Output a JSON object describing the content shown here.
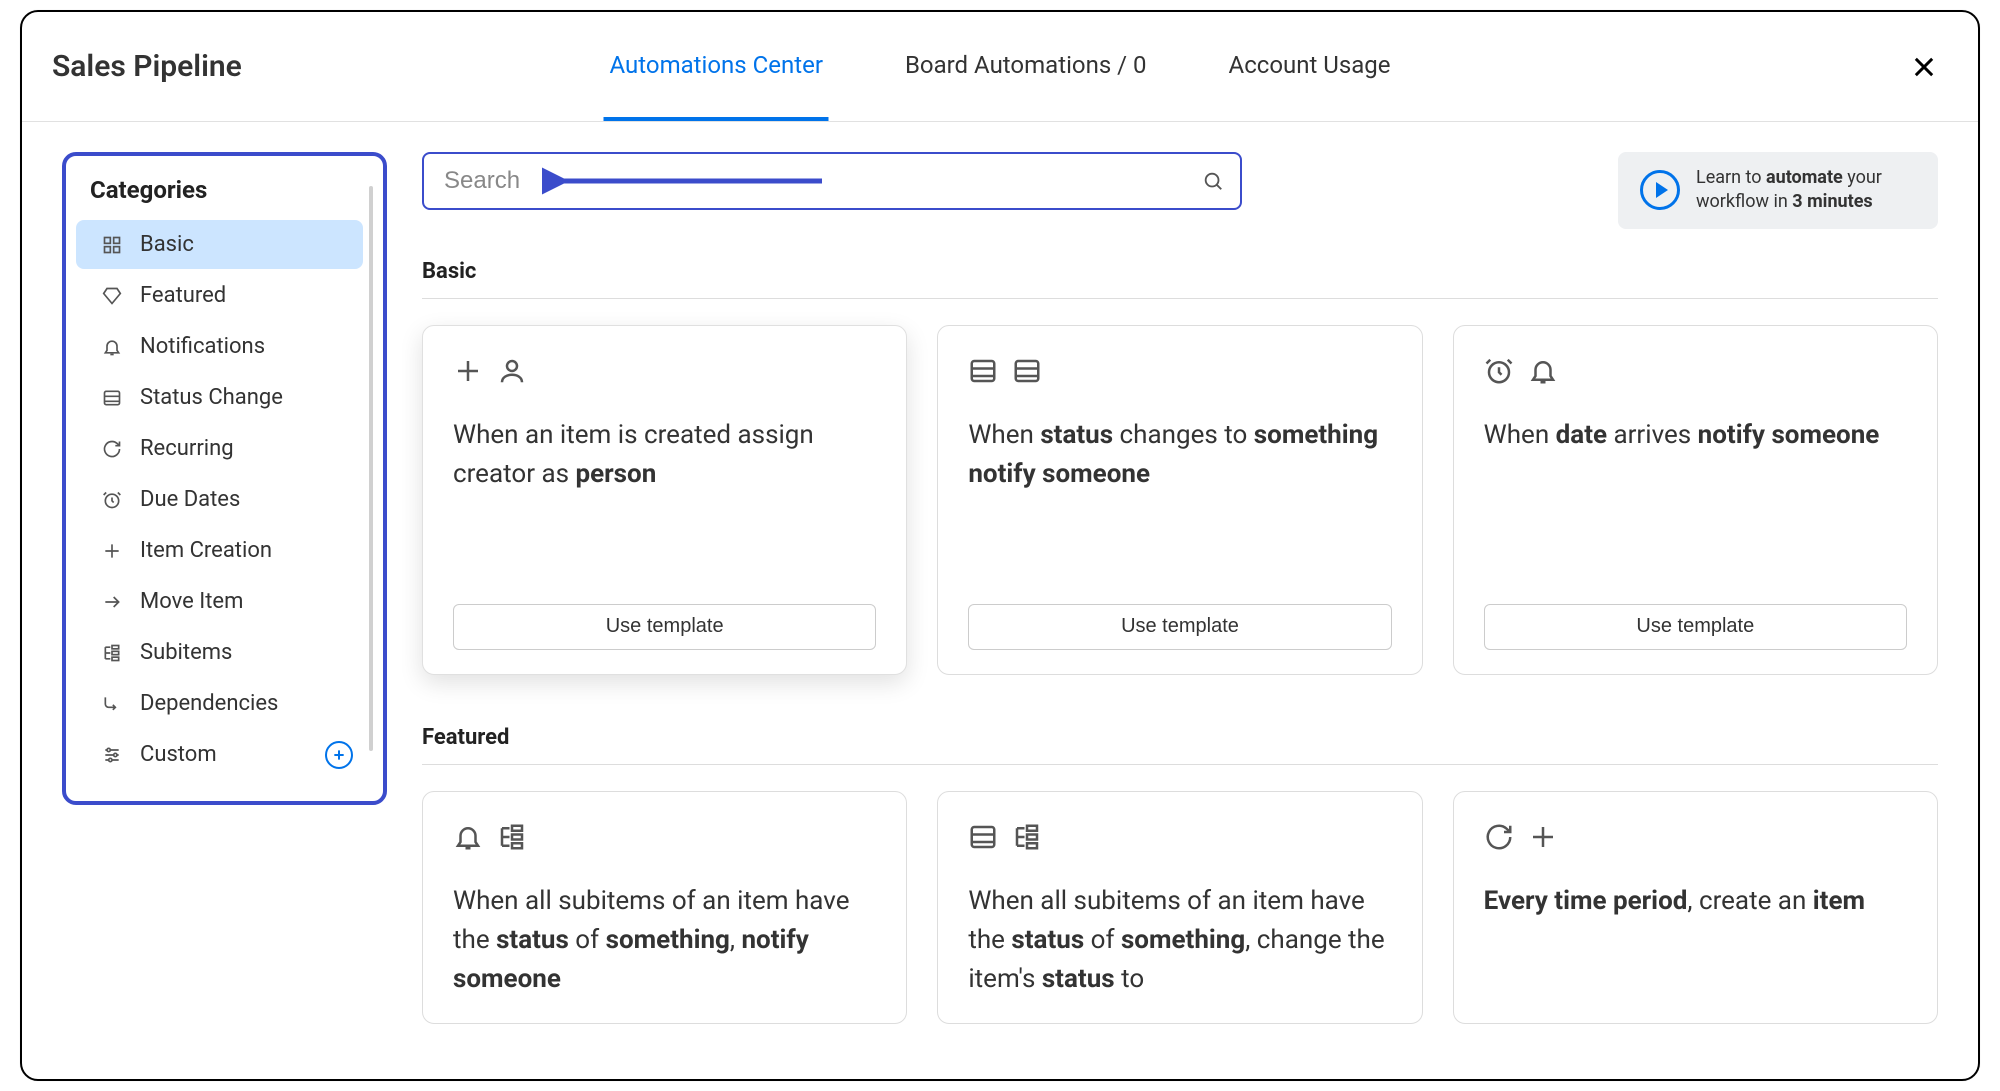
{
  "header": {
    "title": "Sales Pipeline",
    "tabs": [
      {
        "label": "Automations Center",
        "active": true
      },
      {
        "label": "Board Automations / 0",
        "active": false
      },
      {
        "label": "Account Usage",
        "active": false
      }
    ]
  },
  "sidebar": {
    "title": "Categories",
    "items": [
      {
        "label": "Basic",
        "icon": "grid-icon",
        "active": true
      },
      {
        "label": "Featured",
        "icon": "diamond-icon",
        "active": false
      },
      {
        "label": "Notifications",
        "icon": "bell-icon",
        "active": false
      },
      {
        "label": "Status Change",
        "icon": "list-icon",
        "active": false
      },
      {
        "label": "Recurring",
        "icon": "refresh-icon",
        "active": false
      },
      {
        "label": "Due Dates",
        "icon": "clock-icon",
        "active": false
      },
      {
        "label": "Item Creation",
        "icon": "plus-icon",
        "active": false
      },
      {
        "label": "Move Item",
        "icon": "arrow-right-icon",
        "active": false
      },
      {
        "label": "Subitems",
        "icon": "tree-icon",
        "active": false
      },
      {
        "label": "Dependencies",
        "icon": "flow-icon",
        "active": false
      },
      {
        "label": "Custom",
        "icon": "sliders-icon",
        "active": false,
        "add": true
      }
    ]
  },
  "search": {
    "placeholder": "Search"
  },
  "learn": {
    "pre": "Learn to ",
    "bold1": "automate",
    "mid": " your workflow in ",
    "bold2": "3 minutes"
  },
  "sections": {
    "basic": {
      "title": "Basic",
      "cards": [
        {
          "icons": [
            "plus-icon",
            "person-icon"
          ],
          "html": "When an item is created assign creator as <b>person</b>",
          "button": "Use template"
        },
        {
          "icons": [
            "list-icon",
            "list-icon"
          ],
          "html": "When <b>status</b> changes to <b>something</b> <b>notify someone</b>",
          "button": "Use template"
        },
        {
          "icons": [
            "clock-icon",
            "bell-icon"
          ],
          "html": "When <b>date</b> arrives <b>notify someone</b>",
          "button": "Use template"
        }
      ]
    },
    "featured": {
      "title": "Featured",
      "cards": [
        {
          "icons": [
            "bell-icon",
            "tree-icon"
          ],
          "html": "When all subitems of an item have the <b>status</b> of <b>something</b>, <b>notify someone</b>"
        },
        {
          "icons": [
            "list-icon",
            "tree-icon"
          ],
          "html": "When all subitems of an item have the <b>status</b> of <b>something</b>, change the item's <b>status</b> to"
        },
        {
          "icons": [
            "refresh-icon",
            "plus-icon"
          ],
          "html": "<b>Every time period</b>, create an <b>item</b>"
        }
      ]
    }
  }
}
